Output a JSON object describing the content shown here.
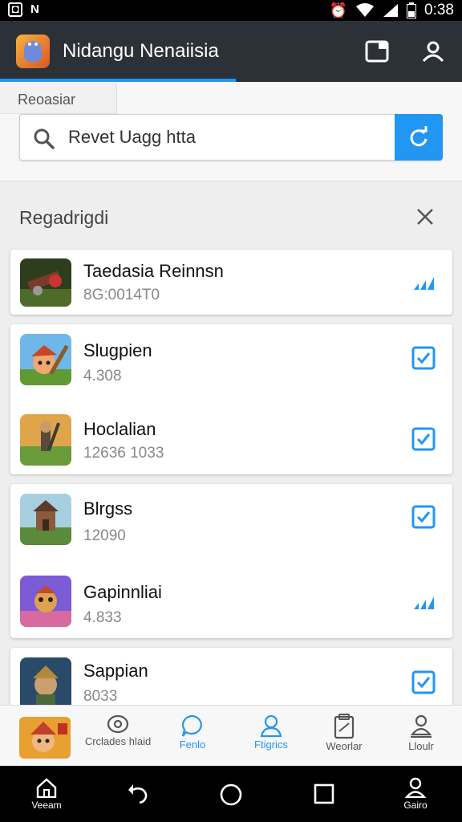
{
  "status_bar": {
    "time": "0:38",
    "left_glyph": "N"
  },
  "app_bar": {
    "title": "Nidangu Nenaiisia",
    "logo_icon": "app-logo-icon",
    "actions": [
      "window-icon",
      "profile-icon"
    ]
  },
  "search": {
    "tab_label": "Reoasiar",
    "value": "Revet Uagg htta"
  },
  "section": {
    "title": "Regadrigdi"
  },
  "items": [
    {
      "name": "Taedasia Reinnsn",
      "sub": "8G:0014T0",
      "status": "signal"
    },
    {
      "name": "Slugpien",
      "sub": "4.308",
      "status": "checked"
    },
    {
      "name": "Hoclalian",
      "sub": "12636 1033",
      "status": "checked"
    },
    {
      "name": "Blrgss",
      "sub": "12090",
      "status": "checked"
    },
    {
      "name": "Gapinnliai",
      "sub": "4.833",
      "status": "signal"
    },
    {
      "name": "Sappian",
      "sub": "8033",
      "status": "checked"
    }
  ],
  "bottom_nav": [
    {
      "label": "Crclades hlaid",
      "icon": "eye-icon",
      "active": false
    },
    {
      "label": "Fenlo",
      "icon": "chat-icon",
      "active": true
    },
    {
      "label": "Ftigrics",
      "icon": "user-icon",
      "active": true
    },
    {
      "label": "Weorlar",
      "icon": "clipboard-icon",
      "active": false
    },
    {
      "label": "Lloulr",
      "icon": "person-icon",
      "active": false
    }
  ],
  "system_nav": {
    "home_label": "Veeam",
    "right_label": "Gairo"
  },
  "colors": {
    "accent": "#2196f3",
    "appbar": "#2c3037",
    "check": "#2196f3"
  }
}
